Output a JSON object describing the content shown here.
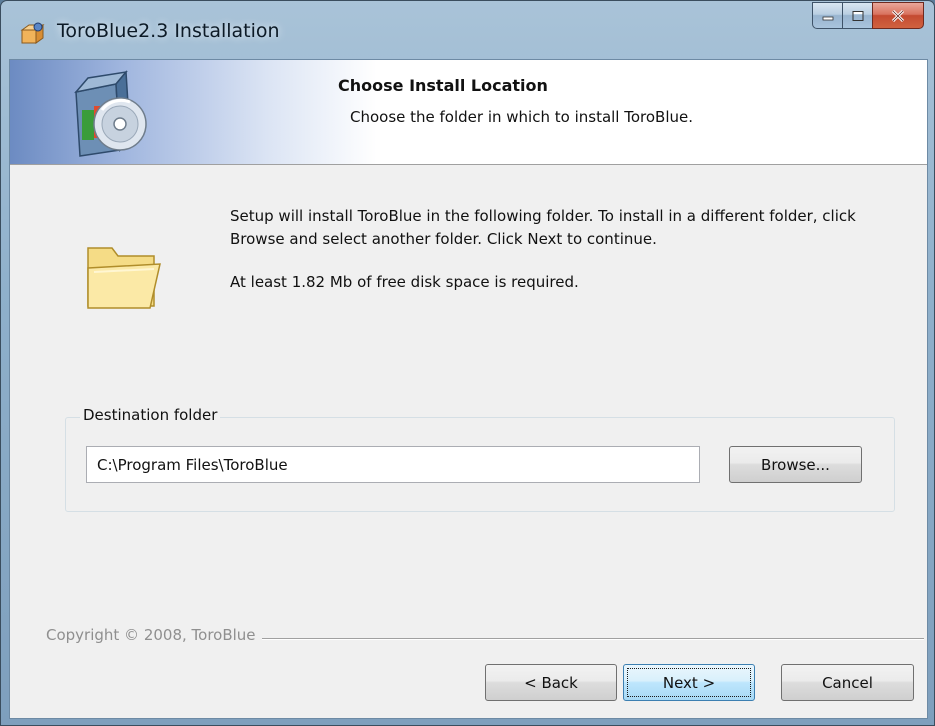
{
  "window": {
    "title": "ToroBlue2.3 Installation",
    "controls": {
      "minimize": "minimize",
      "maximize": "maximize",
      "close": "close"
    }
  },
  "header": {
    "title": "Choose Install Location",
    "subtitle": "Choose the folder in which to install ToroBlue."
  },
  "body": {
    "description": "Setup will install ToroBlue in the following folder. To install in a different folder, click Browse and select another folder. Click Next to continue.",
    "space_required": "At least 1.82 Mb of free disk space is required."
  },
  "destination": {
    "group_label": "Destination folder",
    "path": "C:\\Program Files\\ToroBlue",
    "browse_label": "Browse..."
  },
  "footer": {
    "copyright": "Copyright © 2008, ToroBlue",
    "back_label": "< Back",
    "next_label": "Next >",
    "cancel_label": "Cancel"
  },
  "icons": {
    "app": "installer-box-icon",
    "header": "software-box-cd-icon",
    "folder": "open-folder-icon"
  },
  "colors": {
    "title_bar": "#8fb0cb",
    "close_button": "#c44a31",
    "default_button": "#a7d9f5",
    "folder": "#f2d675"
  }
}
